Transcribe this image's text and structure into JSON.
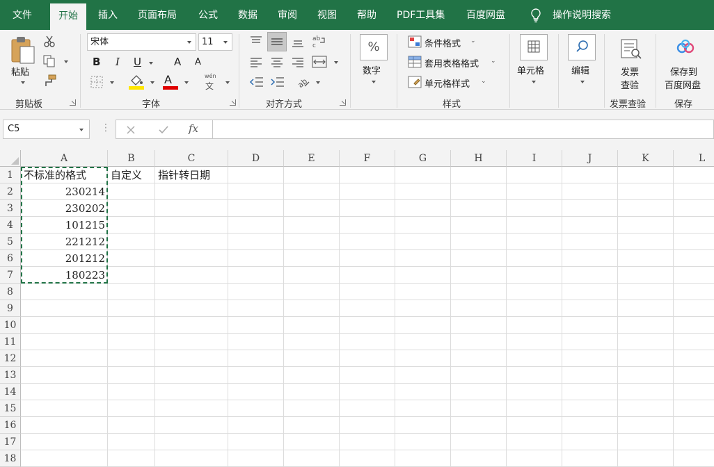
{
  "tabs": [
    "文件",
    "开始",
    "插入",
    "页面布局",
    "公式",
    "数据",
    "审阅",
    "视图",
    "帮助",
    "PDF工具集",
    "百度网盘"
  ],
  "tell_me": "操作说明搜索",
  "ribbon": {
    "clipboard": {
      "paste": "粘贴",
      "label": "剪贴板"
    },
    "font": {
      "name": "宋体",
      "size": "11",
      "bold": "B",
      "italic": "I",
      "underline": "U",
      "grow": "A",
      "shrink": "A",
      "color_a": "A",
      "phonetic_top": "wén",
      "phonetic_bottom": "文",
      "label": "字体",
      "fill_color": "#ffe600",
      "font_color": "#e00000"
    },
    "alignment": {
      "label": "对齐方式"
    },
    "number": {
      "percent": "%",
      "label": "数字"
    },
    "styles": {
      "conditional": "条件格式",
      "table": "套用表格格式",
      "cell": "单元格样式",
      "label": "样式"
    },
    "cells": {
      "label": "单元格"
    },
    "editing": {
      "label": "编辑"
    },
    "invoice": {
      "btn_line1": "发票",
      "btn_line2": "查验",
      "label": "发票查验"
    },
    "save": {
      "btn_line1": "保存到",
      "btn_line2": "百度网盘",
      "label": "保存"
    }
  },
  "formula_bar": {
    "name_box": "C5",
    "fx": "fx",
    "value": ""
  },
  "sheet": {
    "columns": [
      "A",
      "B",
      "C",
      "D",
      "E",
      "F",
      "G",
      "H",
      "I",
      "J",
      "K",
      "L"
    ],
    "rows": [
      "1",
      "2",
      "3",
      "4",
      "5",
      "6",
      "7",
      "8",
      "9",
      "10",
      "11",
      "12",
      "13",
      "14",
      "15",
      "16",
      "17",
      "18"
    ],
    "headers": {
      "a1": "不标准的格式",
      "b1": "自定义",
      "c1": "指针转日期"
    },
    "values": [
      "230214",
      "230202",
      "101215",
      "221212",
      "201212",
      "180223"
    ]
  },
  "colors": {
    "accent": "#217346"
  }
}
